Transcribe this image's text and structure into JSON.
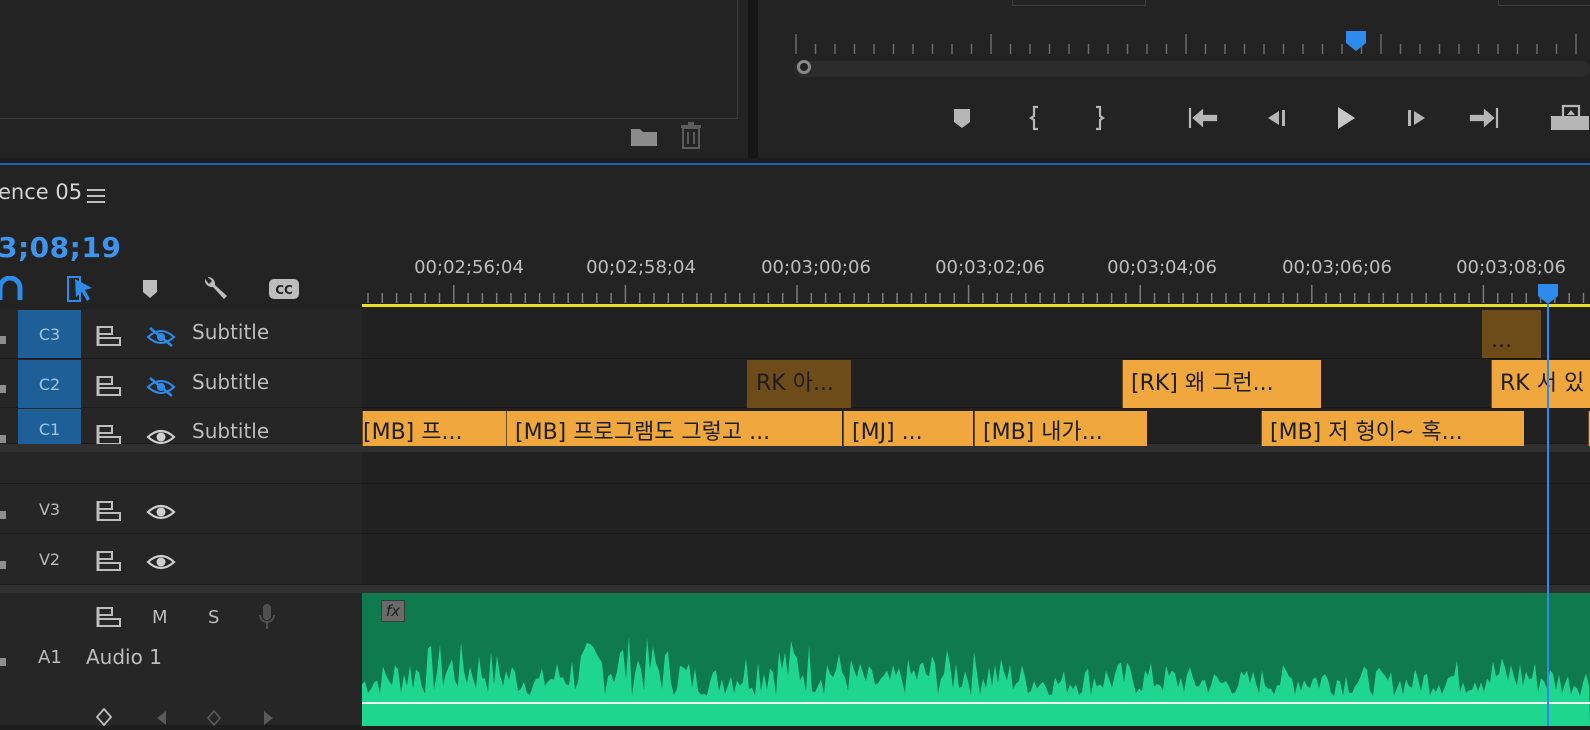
{
  "monitor": {
    "blue_text": "",
    "buttons": [
      "marker-icon",
      "mark-in-icon",
      "mark-out-icon",
      "go-to-in-icon",
      "step-back-icon",
      "play-icon",
      "step-forward-icon",
      "go-to-out-icon",
      "export-frame-icon"
    ]
  },
  "project": {
    "folder_icon": "new-bin-icon",
    "trash_icon": "trash-icon"
  },
  "timeline": {
    "sequence_title": "ence 05",
    "timecode": "3;08;19",
    "tools": [
      "snap-icon",
      "linked-selection-icon",
      "add-marker-icon",
      "settings-wrench-icon",
      "closed-captions-icon"
    ],
    "ruler_labels": [
      "00;02;56;04",
      "00;02;58;04",
      "00;03;00;06",
      "00;03;02;06",
      "00;03;04;06",
      "00;03;06;06",
      "00;03;08;06"
    ],
    "colors": {
      "accent": "#2d8ceb",
      "clip": "#f0a73d",
      "clip_dark": "#6e4c1a",
      "audio": "#0e7a4e",
      "waveform": "#1fd68f",
      "work_area": "#e6e02c"
    }
  },
  "tracks": {
    "c3": {
      "id": "C3",
      "name": "Subtitle",
      "eye": "hidden"
    },
    "c2": {
      "id": "C2",
      "name": "Subtitle",
      "eye": "hidden"
    },
    "c1": {
      "id": "C1",
      "name": "Subtitle",
      "eye": "visible"
    },
    "v3": {
      "id": "V3"
    },
    "v2": {
      "id": "V2"
    },
    "a1": {
      "id": "A1",
      "name": "Audio 1",
      "mute": "M",
      "solo": "S"
    }
  },
  "clips": {
    "c3": [
      "..."
    ],
    "c2": [
      "RK 아...",
      "[RK] 왜 그런...",
      "RK 서 있"
    ],
    "c1": [
      "[MB] 프...",
      "[MB] 프로그램도 그렇고 ...",
      "[MJ] ...",
      "[MB] 내가...",
      "[MB] 저 형이~ 혹..."
    ]
  },
  "audio_clip": {
    "fx": "fx"
  }
}
